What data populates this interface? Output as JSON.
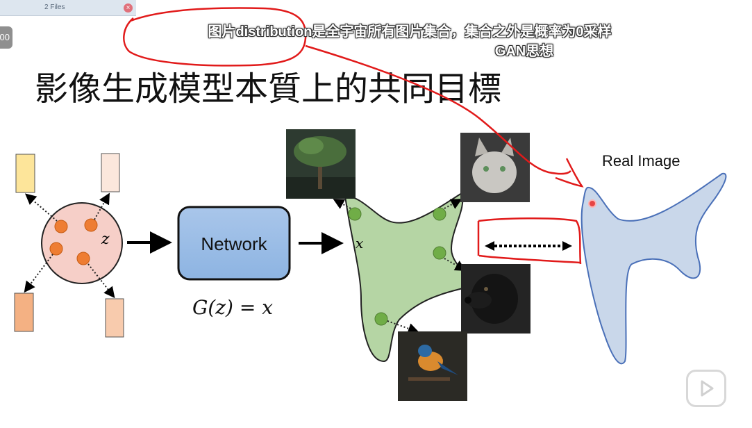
{
  "file_tab": {
    "label": "2 Files",
    "close_icon": "close-icon"
  },
  "page_badge": "00",
  "subtitles": {
    "line1": "图片distribution是全宇宙所有图片集合，集合之外是概率为0采样",
    "line2": "GAN思想"
  },
  "slide": {
    "title": "影像生成模型本質上的共同目標",
    "latent_label": "z",
    "network_label": "Network",
    "formula": "G(z) = x",
    "x_label": "x",
    "real_image_label": "Real Image",
    "images": [
      "tree-image",
      "cat-image",
      "dog-image",
      "bird-image"
    ]
  },
  "colors": {
    "latent_circle": "#f6cfc8",
    "latent_dot": "#ee7d33",
    "network_box": "#8db4e2",
    "generated_dist": "#b5d5a4",
    "real_dist": "#c9d7ea",
    "annotation_red": "#e11a1a"
  },
  "overlay": {
    "play_icon": "play-icon"
  }
}
